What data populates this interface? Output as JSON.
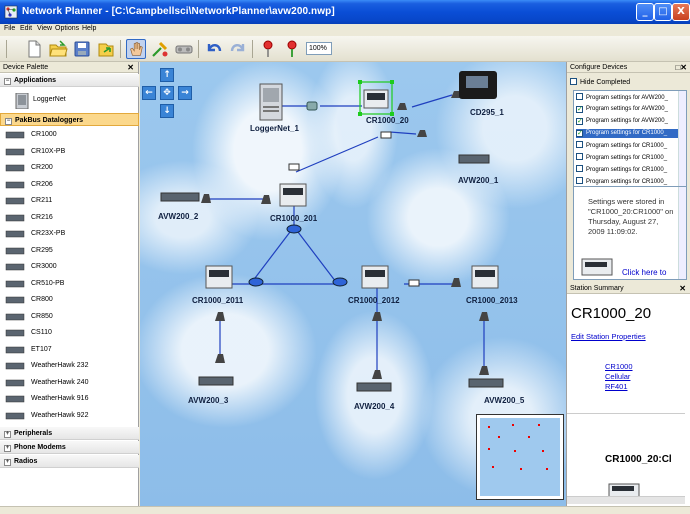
{
  "window": {
    "title": "Network Planner - [C:\\Campbellsci\\NetworkPlanner\\avw200.nwp]",
    "controls": [
      "_",
      "□",
      "X"
    ]
  },
  "menu": [
    "File",
    "Edit",
    "View",
    "Options",
    "Help"
  ],
  "toolbar": {
    "zoom": "100%",
    "buttons": [
      "new-file-icon",
      "open-folder-icon",
      "save-icon",
      "export-icon",
      "hand-icon",
      "connect-icon",
      "wizard-icon",
      "undo-icon",
      "redo-icon",
      "pin-red-icon",
      "pin-green-icon"
    ]
  },
  "palette": {
    "title": "Device Palette",
    "groups": [
      {
        "label": "Applications",
        "items": [
          "LoggerNet"
        ]
      },
      {
        "label": "PakBus Dataloggers",
        "items": [
          "CR1000",
          "CR10X-PB",
          "CR200",
          "CR206",
          "CR211",
          "CR216",
          "CR23X-PB",
          "CR295",
          "CR3000",
          "CR510-PB",
          "CR800",
          "CR850",
          "CS110",
          "ET107",
          "WeatherHawk 232",
          "WeatherHawk 240",
          "WeatherHawk 916",
          "WeatherHawk 922"
        ]
      },
      {
        "label": "Peripherals"
      },
      {
        "label": "Phone Modems"
      },
      {
        "label": "Radios"
      }
    ]
  },
  "canvas": {
    "nodes": [
      "LoggerNet_1",
      "CR1000_20",
      "CD295_1",
      "AVW200_1",
      "AVW200_2",
      "CR1000_201",
      "CR1000_2011",
      "CR1000_2012",
      "CR1000_2013",
      "AVW200_3",
      "AVW200_4",
      "AVW200_5"
    ]
  },
  "configure": {
    "title": "Configure Devices",
    "hide_completed": "Hide Completed",
    "tasks": [
      {
        "label": "Program settings for AVW200_",
        "checked": false,
        "selected": false
      },
      {
        "label": "Program settings for AVW200_",
        "checked": true,
        "selected": false
      },
      {
        "label": "Program settings for AVW200_",
        "checked": true,
        "selected": false
      },
      {
        "label": "Program settings for CR1000_",
        "checked": true,
        "selected": true
      },
      {
        "label": "Program settings for CR1000_",
        "checked": false,
        "selected": false
      },
      {
        "label": "Program settings for CR1000_",
        "checked": false,
        "selected": false
      },
      {
        "label": "Program settings for CR1000_",
        "checked": false,
        "selected": false
      },
      {
        "label": "Program settings for CR1000_",
        "checked": false,
        "selected": false
      }
    ],
    "message": "Settings were stored in \"CR1000_20:CR1000\" on Thursday, August 27, 2009 11:09:02.",
    "link": "Click here to"
  },
  "summary": {
    "title": "Station Summary",
    "station": "CR1000_20",
    "edit_link": "Edit Station Properties",
    "components": [
      "CR1000",
      "Cellular",
      "RF401"
    ],
    "bottom": "CR1000_20:Cl"
  },
  "colors": {
    "title_bar": "#0a4ed6",
    "canvas_sky": "#9cc8ee",
    "link_blue": "#0000cc",
    "selection": "#316ac5",
    "palette_active": "#fbd88c"
  }
}
